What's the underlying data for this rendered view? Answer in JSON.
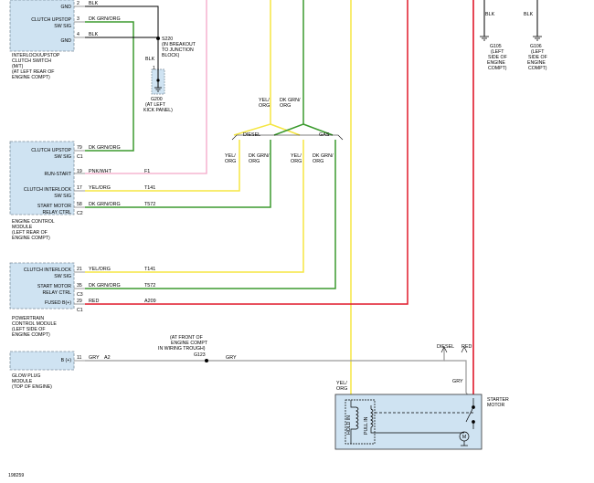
{
  "figure_id": "198259",
  "modules": {
    "clutch_switch": {
      "name_lines": [
        "INTERLOCK/UPSTOP",
        "CLUTCH SWITCH",
        "(M/T)",
        "(AT LEFT REAR OF",
        "ENGINE COMPT)"
      ],
      "pins": [
        {
          "label": "GND",
          "pin": "2",
          "wire": "BLK"
        },
        {
          "label": "CLUTCH UPSTOP",
          "label2": "SW SIG",
          "pin": "3",
          "wire": "DK GRN/ORG"
        },
        {
          "label": "GND",
          "pin": "4",
          "wire": "BLK"
        }
      ]
    },
    "ecm": {
      "name_lines": [
        "ENGINE CONTROL",
        "MODULE",
        "(LEFT REAR OF",
        "ENGINE COMPT)"
      ],
      "pins": [
        {
          "label": "CLUTCH UPSTOP",
          "label2": "SW SIG",
          "connector": "C1",
          "pin": "79",
          "wire": "DK GRN/ORG",
          "circuit": ""
        },
        {
          "label": "RUN-START",
          "pin": "19",
          "wire": "PNK/WHT",
          "circuit": "F1"
        },
        {
          "label": "CLUTCH INTERLOCK",
          "label2": "SW SIG",
          "pin": "17",
          "wire": "YEL/ORG",
          "circuit": "T141"
        },
        {
          "label": "START MOTOR",
          "label2": "RELAY CTRL",
          "connector": "C2",
          "pin": "58",
          "wire": "DK GRN/ORG",
          "circuit": "T572"
        }
      ]
    },
    "pcm": {
      "name_lines": [
        "POWERTRAIN",
        "CONTROL MODULE",
        "(LEFT SIDE OF",
        "ENGINE COMPT)"
      ],
      "pins": [
        {
          "label": "CLUTCH INTERLOCK",
          "label2": "SW SIG",
          "pin": "21",
          "wire": "YEL/ORG",
          "circuit": "T141"
        },
        {
          "label": "START MOTOR",
          "label2": "RELAY CTRL",
          "connector": "C3",
          "pin": "35",
          "wire": "DK GRN/ORG",
          "circuit": "T572"
        },
        {
          "label": "FUSED B(+)",
          "connector": "C1",
          "pin": "29",
          "wire": "RED",
          "circuit": "A209"
        }
      ]
    },
    "glow_plug": {
      "name_lines": [
        "GLOW PLUG",
        "MODULE",
        "(TOP OF ENGINE)"
      ],
      "pins": [
        {
          "label": "B (+)",
          "pin": "11",
          "wire": "GRY",
          "circuit": "A2"
        }
      ]
    },
    "starter": {
      "name_lines": [
        "STARTER",
        "MOTOR"
      ],
      "coil1": "HOLD IN",
      "coil2": "PULL IN",
      "motor_symbol": "M"
    }
  },
  "splices": {
    "s220": {
      "id": "S220",
      "note_lines": [
        "(IN BREAKOUT",
        "TO JUNCTION",
        "BLOCK)"
      ],
      "wire": "BLK"
    },
    "g200": {
      "id": "G200",
      "note_lines": [
        "(AT LEFT",
        "KICK PANEL)"
      ],
      "pin": "1"
    },
    "g123": {
      "id": "G123",
      "note_lines": [
        "(AT FRONT OF",
        "ENGINE COMPT",
        "IN WIRING TROUGH)"
      ]
    },
    "g105": {
      "id": "G105",
      "note_lines": [
        "(LEFT",
        "SIDE OF",
        "ENGINE",
        "COMPT)"
      ],
      "wire": "BLK"
    },
    "g106": {
      "id": "G106",
      "note_lines": [
        "(LEFT",
        "SIDE OF",
        "ENGINE",
        "COMPT)"
      ],
      "wire": "BLK"
    }
  },
  "wire_labels": {
    "yel_org": [
      "YEL/",
      "ORG"
    ],
    "dk_grn_org": [
      "DK GRN/",
      "ORG"
    ],
    "diesel": "DIESEL",
    "gas": "GAS",
    "gry": "GRY",
    "red": "RED"
  },
  "colors": {
    "black": "#000000",
    "yellow": "#f5e642",
    "green": "#3b9a2e",
    "pink": "#f3a6c8",
    "red": "#e0182a",
    "gray": "#9a9a9a",
    "module_fill": "#cfe3f2"
  }
}
